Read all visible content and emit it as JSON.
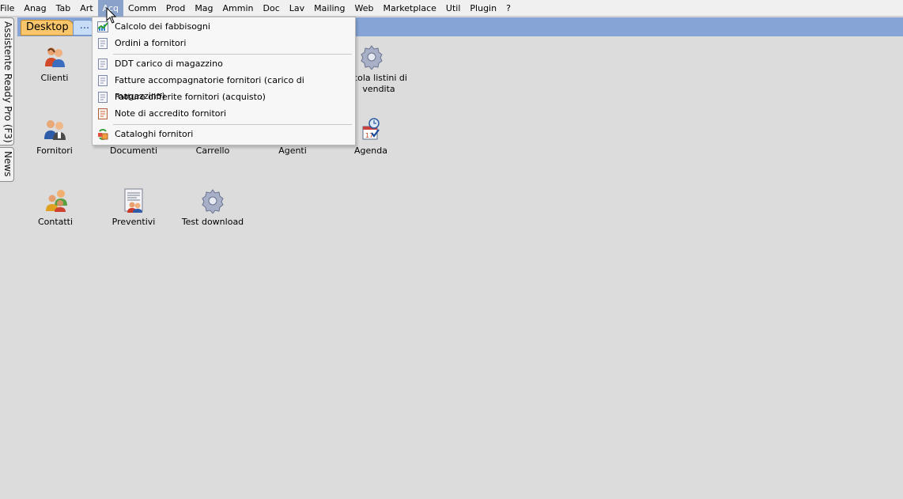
{
  "menubar": {
    "items": [
      {
        "label": "File"
      },
      {
        "label": "Anag"
      },
      {
        "label": "Tab"
      },
      {
        "label": "Art"
      },
      {
        "label": "Acq"
      },
      {
        "label": "Comm"
      },
      {
        "label": "Prod"
      },
      {
        "label": "Mag"
      },
      {
        "label": "Ammin"
      },
      {
        "label": "Doc"
      },
      {
        "label": "Lav"
      },
      {
        "label": "Mailing"
      },
      {
        "label": "Web"
      },
      {
        "label": "Marketplace"
      },
      {
        "label": "Util"
      },
      {
        "label": "Plugin"
      },
      {
        "label": "?"
      }
    ],
    "active_index": 4
  },
  "tabs": {
    "desktop_label": "Desktop",
    "more_label": "..."
  },
  "side_tabs": {
    "assistant_label": "Assistente Ready Pro (F3)",
    "news_label": "News"
  },
  "desktop": {
    "icons": [
      {
        "label": "Clienti",
        "icon": "customers-icon"
      },
      {
        "label": "Fornitori",
        "icon": "suppliers-icon"
      },
      {
        "label": "Documenti",
        "icon": "documents-icon"
      },
      {
        "label": "Carrello",
        "icon": "cart-icon"
      },
      {
        "label": "Agenti",
        "icon": "agents-icon"
      },
      {
        "label": "lcola listini di vendita",
        "icon": "gear-icon"
      },
      {
        "label": "Agenda",
        "icon": "agenda-icon"
      },
      {
        "label": "Contatti",
        "icon": "contacts-icon"
      },
      {
        "label": "Preventivi",
        "icon": "quotes-icon"
      },
      {
        "label": "Test download",
        "icon": "gear-icon"
      }
    ]
  },
  "dropdown": {
    "items": [
      {
        "label": "Calcolo dei fabbisogni",
        "icon": "chart-icon"
      },
      {
        "label": "Ordini a fornitori",
        "icon": "document-icon"
      },
      {
        "label": "DDT carico di magazzino",
        "icon": "document-icon"
      },
      {
        "label": "Fatture accompagnatorie fornitori (carico di magazzino)",
        "icon": "document-icon"
      },
      {
        "label": "Fatture differite fornitori (acquisto)",
        "icon": "document-icon"
      },
      {
        "label": "Note di accredito fornitori",
        "icon": "credit-note-icon"
      },
      {
        "label": "Cataloghi fornitori",
        "icon": "catalog-icon"
      }
    ]
  },
  "colors": {
    "desktop_bg": "#dcdcdc",
    "tabstrip_bg": "#86a4d6",
    "tab_active": "#f9c66b",
    "menu_highlight": "#8aa2c9"
  }
}
